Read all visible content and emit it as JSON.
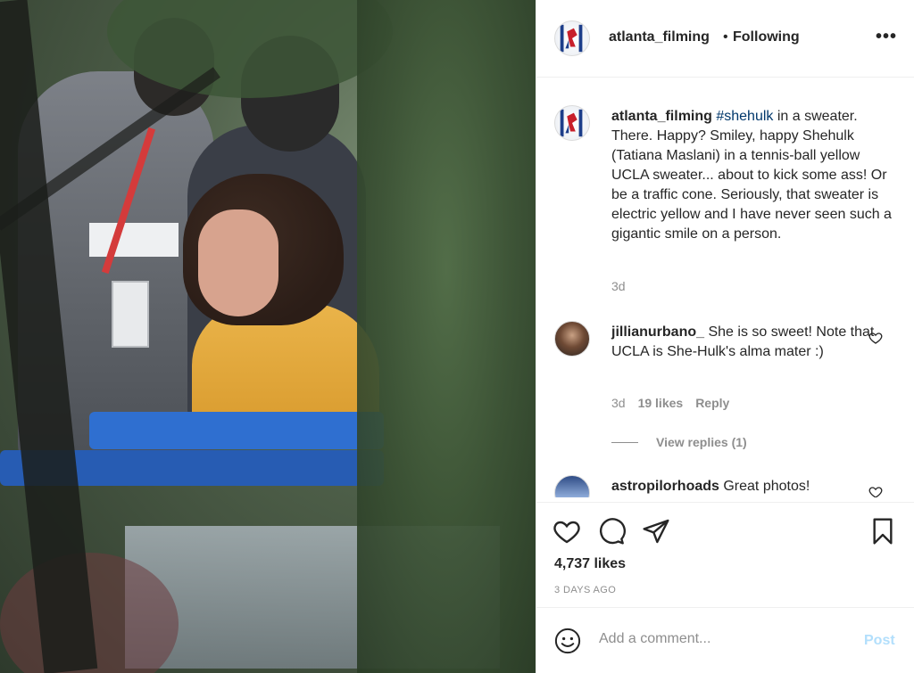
{
  "post": {
    "username": "atlanta_filming",
    "separator": "•",
    "follow_status": "Following",
    "more_label": "•••"
  },
  "caption": {
    "username": "atlanta_filming",
    "hashtag": "#shehulk",
    "text": "in a sweater. There. Happy? Smiley, happy Shehulk (Tatiana Maslani) in a tennis-ball yellow UCLA sweater... about to kick some ass! Or be a traffic cone. Seriously, that sweater is electric yellow and I have never seen such a gigantic smile on a person.",
    "age": "3d"
  },
  "comments": [
    {
      "username": "jillianurbano_",
      "text": "She is so sweet! Note that UCLA is She-Hulk's alma mater :)",
      "age": "3d",
      "likes": "19 likes",
      "reply": "Reply",
      "view_replies": "View replies (1)"
    },
    {
      "username": "astropilorhoads",
      "text": "Great photos!"
    }
  ],
  "stats": {
    "likes": "4,737 likes",
    "posted": "3 DAYS AGO"
  },
  "composer": {
    "placeholder": "Add a comment...",
    "post_label": "Post"
  },
  "icons": {
    "heart": "heart-icon",
    "comment": "comment-icon",
    "share": "paper-plane-icon",
    "save": "bookmark-icon",
    "emoji": "emoji-icon",
    "more": "more-icon"
  },
  "colors": {
    "hashtag": "#00376b",
    "post_disabled": "#b2dffc",
    "muted": "#8e8e8e",
    "text": "#262626"
  }
}
